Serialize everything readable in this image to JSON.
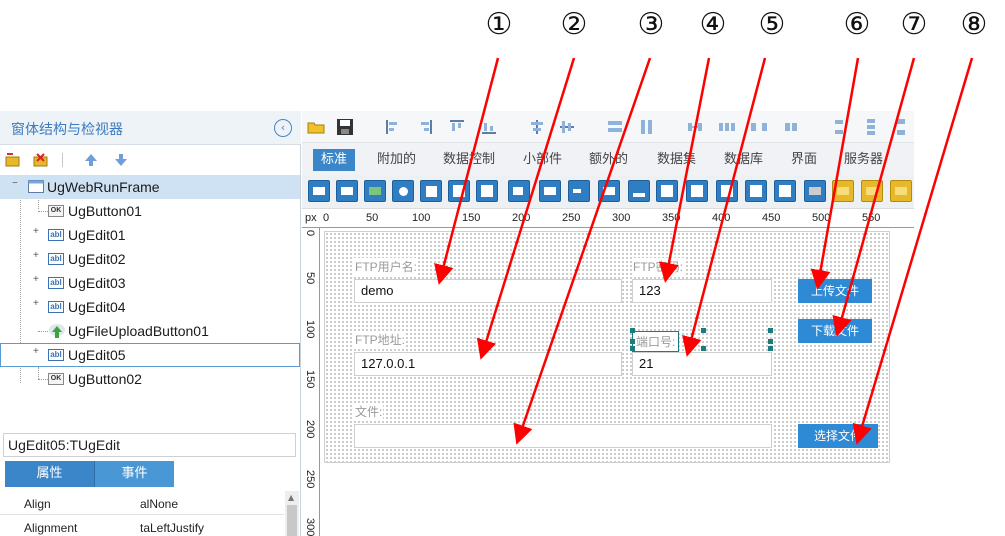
{
  "window_title": "窗体结构与检视器",
  "colors": {
    "accent": "#3a86c8",
    "arrow": "#ff0000",
    "selected_row": "#cfe2f3"
  },
  "annotations": [
    "①",
    "②",
    "③",
    "④",
    "⑤",
    "⑥",
    "⑦",
    "⑧"
  ],
  "tree": {
    "items": [
      {
        "label": "UgWebRunFrame",
        "icon": "frame-icon"
      },
      {
        "label": "UgButton01",
        "icon": "button-icon",
        "icon_text": "OK"
      },
      {
        "label": "UgEdit01",
        "icon": "edit-icon",
        "icon_text": "abl"
      },
      {
        "label": "UgEdit02",
        "icon": "edit-icon",
        "icon_text": "abl"
      },
      {
        "label": "UgEdit03",
        "icon": "edit-icon",
        "icon_text": "abl"
      },
      {
        "label": "UgEdit04",
        "icon": "edit-icon",
        "icon_text": "abl"
      },
      {
        "label": "UgFileUploadButton01",
        "icon": "upload-icon"
      },
      {
        "label": "UgEdit05",
        "icon": "edit-icon",
        "icon_text": "abl"
      },
      {
        "label": "UgButton02",
        "icon": "button-icon",
        "icon_text": "OK"
      }
    ]
  },
  "inspector": {
    "selected": "UgEdit05:TUgEdit",
    "tabs": [
      "属性",
      "事件"
    ],
    "properties": [
      {
        "name": "Align",
        "value": "alNone"
      },
      {
        "name": "Alignment",
        "value": "taLeftJustify"
      }
    ]
  },
  "component_tabs": [
    "标准",
    "附加的",
    "数据控制",
    "小部件",
    "额外的",
    "数据集",
    "数据库",
    "界面",
    "服务器"
  ],
  "ruler": {
    "unit": "px",
    "top_ticks": [
      "0",
      "50",
      "100",
      "150",
      "200",
      "250",
      "300",
      "350",
      "400",
      "450",
      "500",
      "550"
    ],
    "left_ticks": [
      "0",
      "50",
      "100",
      "150",
      "200",
      "250",
      "300"
    ]
  },
  "form": {
    "ftp_user_label": "FTP用户名:",
    "ftp_user_value": "demo",
    "ftp_pass_label": "FTP密码:",
    "ftp_pass_value": "123",
    "ftp_addr_label": "FTP地址:",
    "ftp_addr_value": "127.0.0.1",
    "port_label": "端口号:",
    "port_value": "21",
    "file_label": "文件:",
    "file_value": "",
    "upload_btn": "上传文件",
    "download_btn": "下载文件",
    "choose_btn": "选择文件"
  }
}
